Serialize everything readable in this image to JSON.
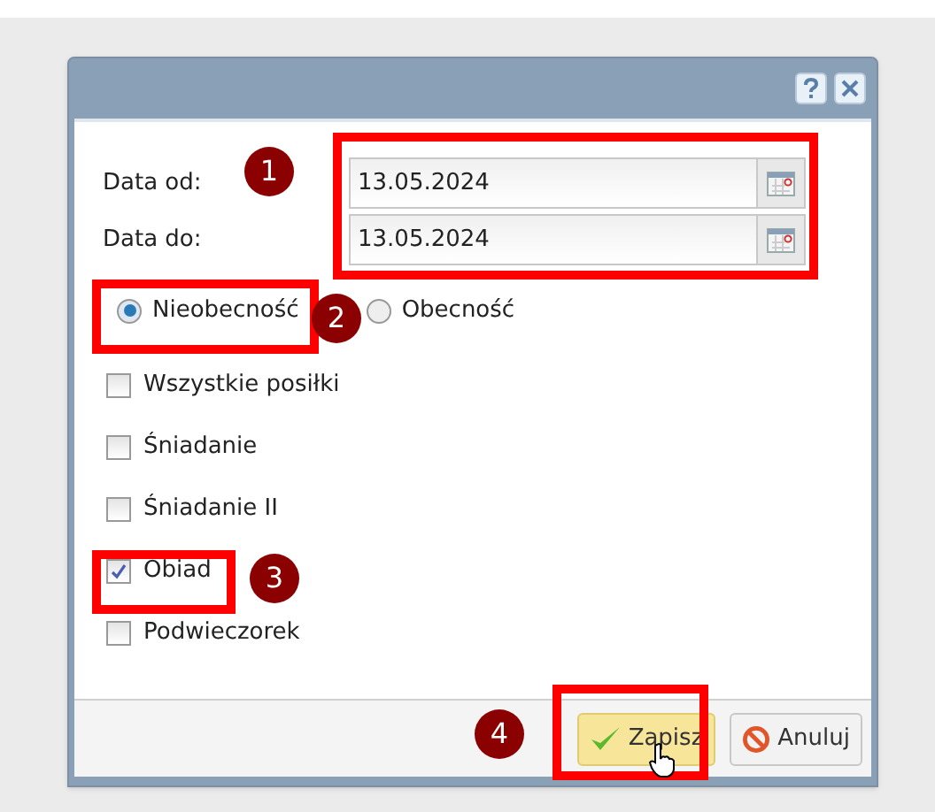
{
  "dialog": {
    "fields": [
      {
        "label": "Data od:",
        "value": "13.05.2024"
      },
      {
        "label": "Data do:",
        "value": "13.05.2024"
      }
    ],
    "radios": [
      {
        "label": "Nieobecność",
        "selected": true
      },
      {
        "label": "Obecność",
        "selected": false
      }
    ],
    "checkboxes": [
      {
        "label": "Wszystkie posiłki",
        "checked": false
      },
      {
        "label": "Śniadanie",
        "checked": false
      },
      {
        "label": "Śniadanie II",
        "checked": false
      },
      {
        "label": "Obiad",
        "checked": true
      },
      {
        "label": "Podwieczorek",
        "checked": false
      }
    ],
    "buttons": [
      {
        "kind": "save",
        "label": "Zapisz",
        "hovered": true
      },
      {
        "kind": "cancel",
        "label": "Anuluj",
        "hovered": false
      }
    ]
  },
  "annotations": [
    {
      "number": "1"
    },
    {
      "number": "2"
    },
    {
      "number": "3"
    },
    {
      "number": "4"
    }
  ]
}
